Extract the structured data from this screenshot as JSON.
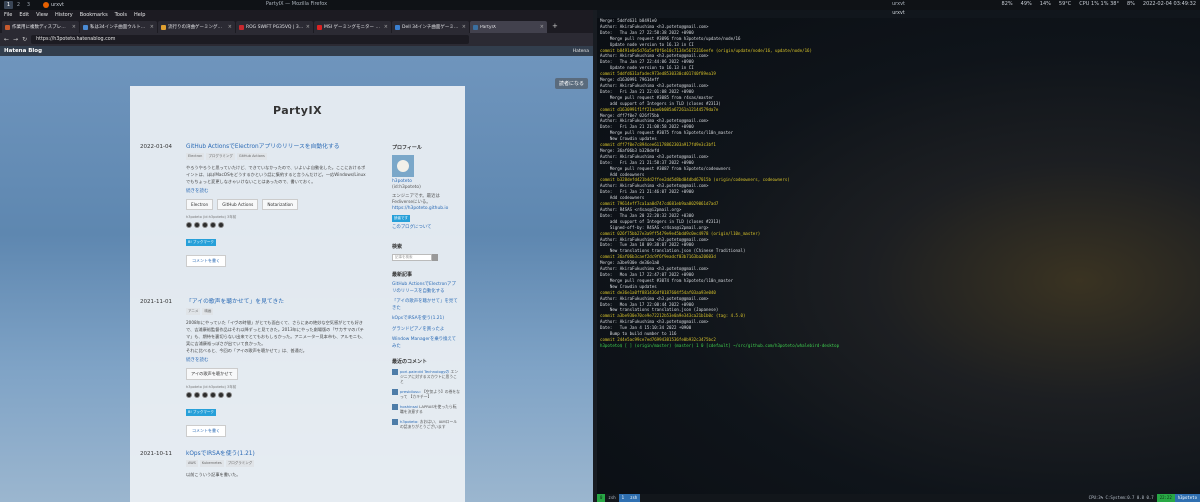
{
  "panel": {
    "workspaces": [
      "1",
      "2",
      "3"
    ],
    "active_workspace": "1",
    "task_label": "urxvt",
    "left_title": "PartyIX — Mozilla Firefox",
    "right_title": "urxvt",
    "tray": [
      "82%",
      "49%",
      "14%",
      "59°C",
      "CPU 1% 1% 38°",
      "8%",
      "2022-02-04 03:49:32"
    ]
  },
  "firefox": {
    "menu": [
      "File",
      "Edit",
      "View",
      "History",
      "Bookmarks",
      "Tools",
      "Help"
    ],
    "tabs": [
      {
        "label": "作業用に複数ディスプレイを1",
        "color": "#c65a2e"
      },
      {
        "label": "私は34インチ曲面ウルトラワイ",
        "color": "#4a8ad4"
      },
      {
        "label": "流行りの湾曲ゲーミングモニター",
        "color": "#e0a030"
      },
      {
        "label": "ROG SWIFT PG35VQ | 34インチ",
        "color": "#c8282e"
      },
      {
        "label": "MSI ゲーミングモニター Optix",
        "color": "#d22"
      },
      {
        "label": "Dell 34インチ曲面ゲーミング",
        "color": "#3a7fd0"
      },
      {
        "label": "PartyIX",
        "color": "#3a6fa0"
      }
    ],
    "url": "https://h3poteto.hatenablog.com",
    "hatena": {
      "logo": "Hatena Blog",
      "right": "Hatena"
    }
  },
  "blog": {
    "readers_button": "読者になる",
    "title": "PartyIX",
    "entries": [
      {
        "date": "2022-01-04",
        "title": "GitHub ActionsでElectronアプリのリリースを自動化する",
        "tags": [
          "Electron",
          "プログラミング",
          "GitHub Actions"
        ],
        "excerpt": "やろうやろうと思っていたけど、できていなかったので、いよいよ自動化した。ここにおけるポイントは、ほぼMacOSをどうするかという話に集約すると言うんだけど。一応Windows/Linuxでもちょっと変更しなきゃいけないことはあったので、書いておく。",
        "more": "続きを読む",
        "cats": [
          "Electron",
          "GitHub Actions",
          "Notarization"
        ],
        "stars": "h3poteto (id:h3poteto) 3年前",
        "bookmark": "B! ブックマーク",
        "comment": "コメントを書く"
      },
      {
        "date": "2021-11-01",
        "title": "「アイの歌声を聴かせて」を見てきた",
        "tags": [
          "アニメ",
          "映画"
        ],
        "excerpt": "2008年にやっていた「イヴの時間」がとても面白くて、さらにあの絶妙な空気感がとても好きで、吉浦康裕監督作品はそれ以降ずっと見てきた。2013年にやった劇場版の「サカサマのパテマ」も、期待を裏切らない出来でとてもおもしろかった。アニメーター見本市も、アルモニも、実に吉浦康裕っぽさが出ていて良かった。\nそれに比べると、今回の「アイの歌声を聴かせて」は、普通だ。",
        "more": "続きを読む",
        "cats": [
          "アイの歌声を聴かせて"
        ],
        "stars": "h3poteto (id:h3poteto) 3年前",
        "bookmark": "B! ブックマーク",
        "comment": "コメントを書く"
      },
      {
        "date": "2021-10-11",
        "title": "kOpsでIRSAを使う(1.21)",
        "tags": [
          "AWS",
          "Kubernetes",
          "プログラミング"
        ],
        "excerpt": "以前こういう記事を書いた。"
      }
    ],
    "sidebar": {
      "profile_head": "プロフィール",
      "profile_name": "h3poteto",
      "profile_id": "(id:h3poteto)",
      "profile_desc": "エンジニアです。最近はFediverseにいる。",
      "profile_link": "https://h3poteto.github.io",
      "reader_btn": "読者です",
      "about": "このブログについて",
      "search_head": "検索",
      "search_placeholder": "記事を検索",
      "recent_head": "最新記事",
      "recent": [
        "GitHub ActionsでElectronアプリのリリースを自動化する",
        "「アイの歌声を聴かせて」を見てきた",
        "kOpsでIRSAを使う(1.21)",
        "グランドピアノを買ったよ",
        "Window Managerを乗り換えてみた"
      ],
      "comments_head": "最近のコメント",
      "comments": [
        {
          "user": "pori-paie:dd Technologyの",
          "text": "エンジニアに対するスカウトに思うこと"
        },
        {
          "user": "presbilusu:",
          "text": "【空気よう】の巻をなって 【カキチー】"
        },
        {
          "user": "hoshinsai",
          "text": "LAPRASを使ったら転職を決意する"
        },
        {
          "user": "h3poteto:",
          "text": "おおはい、IAMロールの話ありがとうございます"
        }
      ]
    }
  },
  "terminal": {
    "title": "urxvt",
    "lines": [
      {
        "t": "Merge: 5ddfd631 b8491e0",
        "c": ""
      },
      {
        "t": "Author: AkiraFukushima <h3.poteto@gmail.com>",
        "c": ""
      },
      {
        "t": "Date:   Thu Jan 27 22:58:38 2022 +0900",
        "c": ""
      },
      {
        "t": "",
        "c": ""
      },
      {
        "t": "    Merge pull request #3096 from h3poteto/update/node/16",
        "c": ""
      },
      {
        "t": "",
        "c": ""
      },
      {
        "t": "    Update node version to 16.13 in CI",
        "c": ""
      },
      {
        "t": "",
        "c": ""
      },
      {
        "t": "commit b8491e0e5d76a5ef0f6e10c7134e5672316eefe (origin/update/node/16, update/node/16)",
        "c": "commit"
      },
      {
        "t": "Author: AkiraFukushima <h3.poteto@gmail.com>",
        "c": ""
      },
      {
        "t": "Date:   Thu Jan 27 22:44:06 2022 +0900",
        "c": ""
      },
      {
        "t": "",
        "c": ""
      },
      {
        "t": "    Update node version to 16.13 in CI",
        "c": ""
      },
      {
        "t": "",
        "c": ""
      },
      {
        "t": "commit 5ddfd631afadec973ed8530330cd01740f89ea19",
        "c": "commit"
      },
      {
        "t": "Merge: d1630991 79614eff",
        "c": ""
      },
      {
        "t": "Author: AkiraFukushima <h3.poteto@gmail.com>",
        "c": ""
      },
      {
        "t": "Date:   Fri Jan 21 22:01:08 2022 +0900",
        "c": ""
      },
      {
        "t": "",
        "c": ""
      },
      {
        "t": "    Merge pull request #3085 from r4sas/master",
        "c": ""
      },
      {
        "t": "",
        "c": ""
      },
      {
        "t": "    add support of Integers in TLD (closes #2313)",
        "c": ""
      },
      {
        "t": "",
        "c": ""
      },
      {
        "t": "commit d1630991f1ff21aae0b085a67261a12144579da7e",
        "c": "commit"
      },
      {
        "t": "Merge: dff7f0e7 026f75bb",
        "c": ""
      },
      {
        "t": "Author: AkiraFukushima <h3.poteto@gmail.com>",
        "c": ""
      },
      {
        "t": "Date:   Fri Jan 21 21:08:58 2022 +0900",
        "c": ""
      },
      {
        "t": "",
        "c": ""
      },
      {
        "t": "    Merge pull request #3075 from h3poteto/l10n_master",
        "c": ""
      },
      {
        "t": "",
        "c": ""
      },
      {
        "t": "    New Crowdin updates",
        "c": ""
      },
      {
        "t": "",
        "c": ""
      },
      {
        "t": "commit dff7f0e7c894cee61178862303a917fd9e3c3bf1",
        "c": "commit"
      },
      {
        "t": "Merge: 36af06b3 b328defd",
        "c": ""
      },
      {
        "t": "Author: AkiraFukushima <h3.poteto@gmail.com>",
        "c": ""
      },
      {
        "t": "Date:   Fri Jan 21 21:58:37 2022 +0900",
        "c": ""
      },
      {
        "t": "",
        "c": ""
      },
      {
        "t": "    Merge pull request #3087 from h3poteto/codeowners",
        "c": ""
      },
      {
        "t": "",
        "c": ""
      },
      {
        "t": "    Add codeowners",
        "c": ""
      },
      {
        "t": "",
        "c": ""
      },
      {
        "t": "commit b328defd421b4d2ffee2dd5d8bd04dbd67015b (origin/codeowners, codeowners)",
        "c": "commit"
      },
      {
        "t": "Author: AkiraFukushima <h3.poteto@gmail.com>",
        "c": ""
      },
      {
        "t": "Date:   Fri Jan 21 21:46:07 2022 +0900",
        "c": ""
      },
      {
        "t": "",
        "c": ""
      },
      {
        "t": "    Add codeowners",
        "c": ""
      },
      {
        "t": "",
        "c": ""
      },
      {
        "t": "commit 79614eff7ca1aa0d747cd681eb9aa8029061d7ad7",
        "c": "commit"
      },
      {
        "t": "Author: R4SAS <r4sas@i2pmail.org>",
        "c": ""
      },
      {
        "t": "Date:   Thu Jan 20 22:20:32 2022 +0300",
        "c": ""
      },
      {
        "t": "",
        "c": ""
      },
      {
        "t": "    add support of Integers in TLD (closes #2313)",
        "c": ""
      },
      {
        "t": "",
        "c": ""
      },
      {
        "t": "    Signed-off-by: R4SAS <r4sas@i2pmail.org>",
        "c": ""
      },
      {
        "t": "",
        "c": ""
      },
      {
        "t": "commit 026f75bb27e3a9ff5479e9e45bdd9c0ec4978 (origin/l10n_master)",
        "c": "commit"
      },
      {
        "t": "Author: AkiraFukushima <h3.poteto@gmail.com>",
        "c": ""
      },
      {
        "t": "Date:   Tue Jan 18 09:38:07 2022 +0900",
        "c": ""
      },
      {
        "t": "",
        "c": ""
      },
      {
        "t": "    New translations translation.json (Chinese Traditional)",
        "c": ""
      },
      {
        "t": "",
        "c": ""
      },
      {
        "t": "commit 36af06b3caef2dc9f6f9eadcf03b7163ba20603d",
        "c": "commit"
      },
      {
        "t": "Merge: a3be930e de36e1a0",
        "c": ""
      },
      {
        "t": "Author: AkiraFukushima <h3.poteto@gmail.com>",
        "c": ""
      },
      {
        "t": "Date:   Mon Jan 17 22:47:07 2022 +0900",
        "c": ""
      },
      {
        "t": "",
        "c": ""
      },
      {
        "t": "    Merge pull request #3074 from h3poteto/l10n_master",
        "c": ""
      },
      {
        "t": "",
        "c": ""
      },
      {
        "t": "    New Crowdin updates",
        "c": ""
      },
      {
        "t": "",
        "c": ""
      },
      {
        "t": "commit de36e1a0ff881436df0187604f54af03aa93e040",
        "c": "commit"
      },
      {
        "t": "Author: AkiraFukushima <h3.poteto@gmail.com>",
        "c": ""
      },
      {
        "t": "Date:   Mon Jan 17 22:08:44 2022 +0900",
        "c": ""
      },
      {
        "t": "",
        "c": ""
      },
      {
        "t": "    New translations translation.json (Japanese)",
        "c": ""
      },
      {
        "t": "",
        "c": ""
      },
      {
        "t": "commit a3be930e70ce9e72212b53e0a9e343ca21b1b0c (tag: 4.5.0)",
        "c": "commit"
      },
      {
        "t": "Author: AkiraFukushima <h3.poteto@gmail.com>",
        "c": ""
      },
      {
        "t": "Date:   Tue Jan 4 15:10:34 2022 +0900",
        "c": ""
      },
      {
        "t": "",
        "c": ""
      },
      {
        "t": "    Bump to build number to 116",
        "c": ""
      },
      {
        "t": "",
        "c": ""
      },
      {
        "t": "commit 244e5ac99ce7ed76994381536fe0b932c3475bc2",
        "c": "commit"
      },
      {
        "t": "h3poteto$ [ ] (origin/master) (master) 1 0 [cdefault] ~/src/github.com/h3poteto/whalebird-desktop",
        "c": "prompt"
      }
    ],
    "status_left": [
      "0",
      "zsh",
      "1",
      "zsh"
    ],
    "status_right": [
      "CPU:3% C:System:0.7 0.8 0.7",
      "22:22",
      "h3poteto"
    ]
  }
}
